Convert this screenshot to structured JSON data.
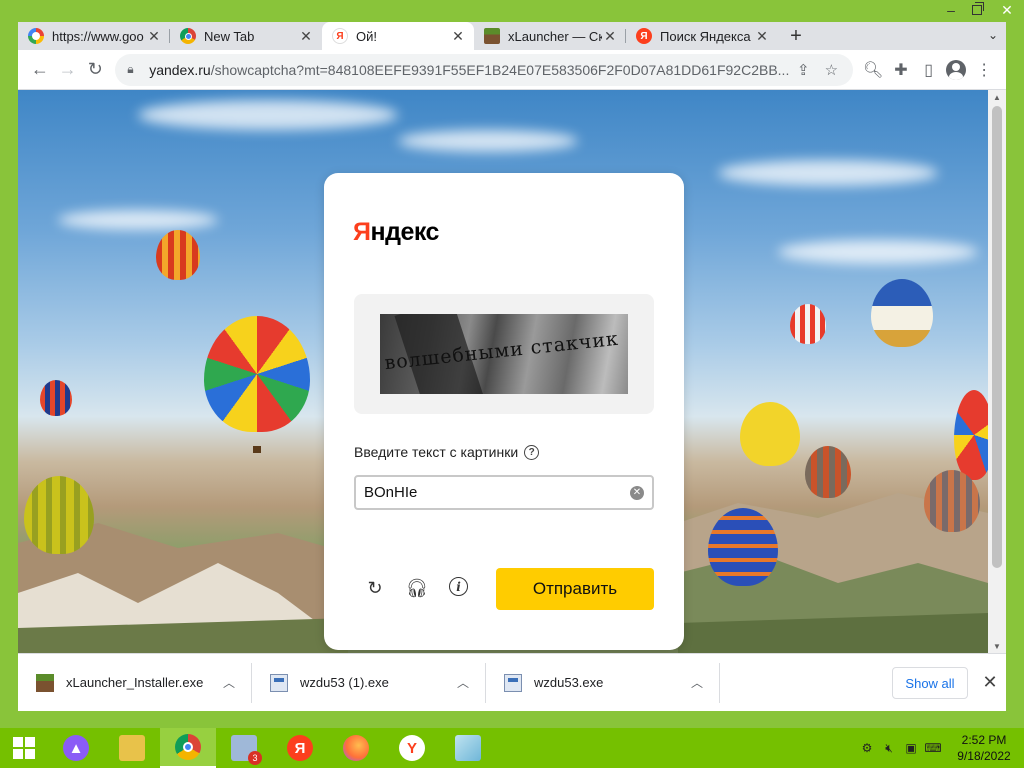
{
  "browser": {
    "tabs": [
      {
        "label": "https://www.goo",
        "icon": "google-icon",
        "active": false
      },
      {
        "label": "New Tab",
        "icon": "chrome-icon",
        "active": false
      },
      {
        "label": "Ой!",
        "icon": "yandex-icon",
        "active": true
      },
      {
        "label": "xLauncher — Ск",
        "icon": "minecraft-icon",
        "active": false
      },
      {
        "label": "Поиск Яндекса",
        "icon": "yandex-search-icon",
        "active": false
      }
    ],
    "url_host": "yandex.ru",
    "url_path": "/showcaptcha?mt=848108EEFE9391F55EF1B24E07E583506F2F0D07A81DD61F92C2BB..."
  },
  "captcha": {
    "logo_first": "Я",
    "logo_rest": "ндекс",
    "captcha_text": "волшебными стакчик",
    "prompt": "Введите текст с картинки",
    "input_value": "BOnHIe",
    "submit_label": "Отправить"
  },
  "downloads": {
    "items": [
      {
        "name": "xLauncher_Installer.exe",
        "icon": "minecraft-icon"
      },
      {
        "name": "wzdu53 (1).exe",
        "icon": "exe-icon"
      },
      {
        "name": "wzdu53.exe",
        "icon": "exe-icon"
      }
    ],
    "show_all_label": "Show all"
  },
  "taskbar": {
    "badge_count": "3",
    "time": "2:52 PM",
    "date": "9/18/2022"
  },
  "colors": {
    "frame": "#89c43a",
    "taskbar": "#75c000",
    "yandex_red": "#fc3f1d",
    "submit_yellow": "#ffcc00"
  }
}
